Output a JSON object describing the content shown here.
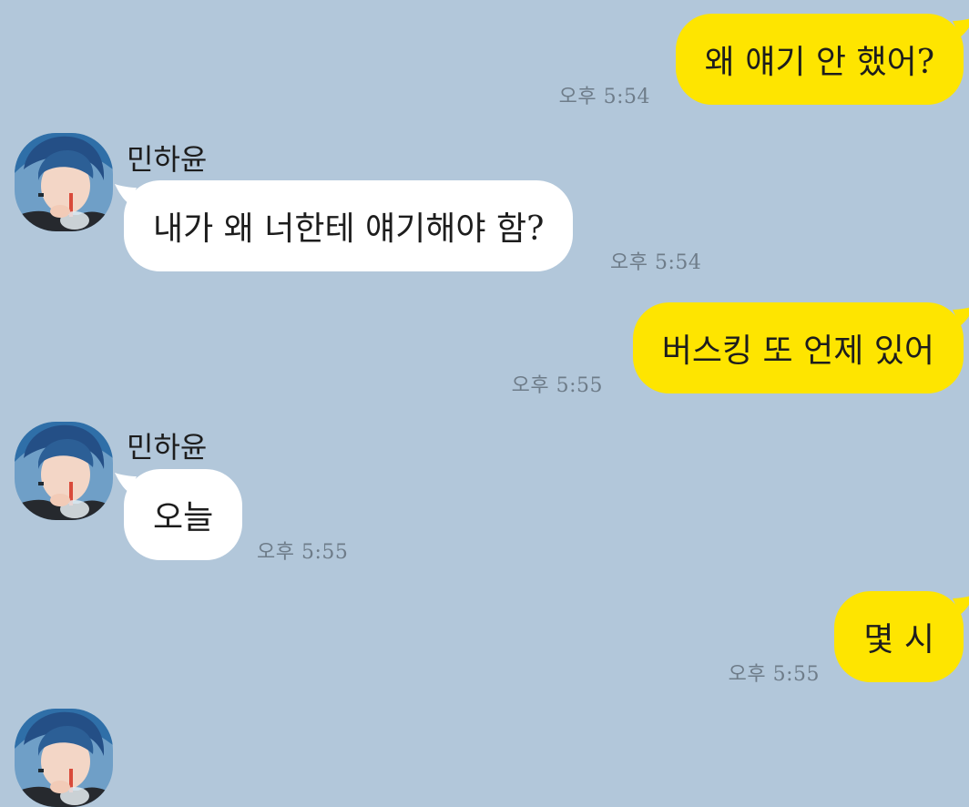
{
  "chat": {
    "contact_name": "민하윤",
    "messages": [
      {
        "sender": "me",
        "text": "왜 얘기 안 했어?",
        "time": "오후 5:54"
      },
      {
        "sender": "them",
        "name": "민하윤",
        "text": "내가 왜 너한테 얘기해야 함?",
        "time": "오후 5:54"
      },
      {
        "sender": "me",
        "text": "버스킹 또 언제 있어",
        "time": "오후 5:55"
      },
      {
        "sender": "them",
        "name": "민하윤",
        "text": "오늘",
        "time": "오후 5:55"
      },
      {
        "sender": "me",
        "text": "몇 시",
        "time": "오후 5:55"
      }
    ]
  },
  "colors": {
    "background": "#b2c7da",
    "my_bubble": "#fee500",
    "their_bubble": "#ffffff",
    "time_text": "#6e7c89",
    "avatar_hair": "#2f6fa8"
  },
  "icons": {
    "avatar": "avatar-icon"
  }
}
